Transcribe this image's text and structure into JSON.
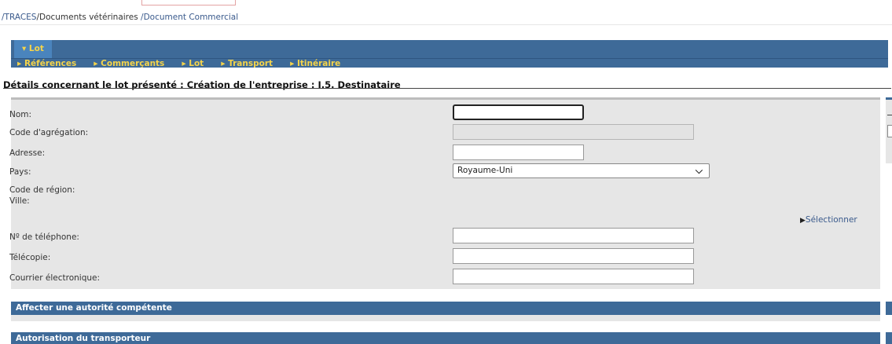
{
  "breadcrumb": {
    "part1": "/TRACES",
    "part2": "/Documents vétérinaires ",
    "part3": "/Document Commercial"
  },
  "lot_tab": {
    "label": "▾ Lot"
  },
  "subnav": [
    {
      "label": "Références"
    },
    {
      "label": "Commerçants"
    },
    {
      "label": "Lot"
    },
    {
      "label": "Transport"
    },
    {
      "label": "Itinéraire"
    }
  ],
  "section_title": "Détails concernant le lot présenté : Création de l'entreprise : I.5. Destinataire",
  "form": {
    "nom_label": "Nom:",
    "nom_value": "",
    "code_agregation_label": "Code d'agrégation:",
    "code_agregation_value": "",
    "adresse_label": "Adresse:",
    "adresse_value": "",
    "pays_label": "Pays:",
    "pays_value": "Royaume-Uni",
    "code_region_label": "Code de région:",
    "ville_label": "Ville:",
    "selectionner_label": "Sélectionner",
    "telephone_label": "Nº de téléphone:",
    "telephone_value": "",
    "telecopie_label": "Télécopie:",
    "telecopie_value": "",
    "courrier_label": "Courrier électronique:",
    "courrier_value": ""
  },
  "sections": {
    "autorite": "Affecter une autorité compétente",
    "transporteur": "Autorisation du transporteur"
  },
  "colors": {
    "header_blue": "#3e6a98",
    "tab_yellow": "#f5d44a",
    "panel_grey": "#e6e6e6",
    "link_blue": "#3a5a8c"
  }
}
